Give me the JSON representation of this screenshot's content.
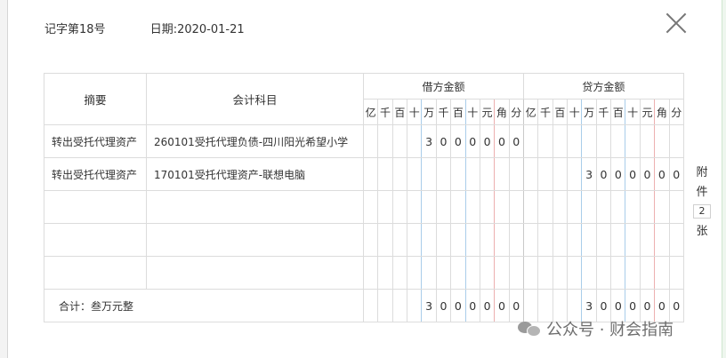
{
  "header": {
    "voucher_no": "记字第18号",
    "date": "日期:2020-01-21"
  },
  "table": {
    "col_summary": "摘要",
    "col_account": "会计科目",
    "debit_label": "借方金额",
    "credit_label": "贷方金额",
    "units": [
      "亿",
      "千",
      "百",
      "十",
      "万",
      "千",
      "百",
      "十",
      "元",
      "角",
      "分"
    ],
    "rows": [
      {
        "summary": "转出受托代理资产",
        "account": "260101受托代理负债-四川阳光希望小学",
        "debit": [
          "",
          "",
          "",
          "",
          "3",
          "0",
          "0",
          "0",
          "0",
          "0",
          "0"
        ],
        "credit": [
          "",
          "",
          "",
          "",
          "",
          "",
          "",
          "",
          "",
          "",
          ""
        ]
      },
      {
        "summary": "转出受托代理资产",
        "account": "170101受托代理资产-联想电脑",
        "debit": [
          "",
          "",
          "",
          "",
          "",
          "",
          "",
          "",
          "",
          "",
          ""
        ],
        "credit": [
          "",
          "",
          "",
          "",
          "3",
          "0",
          "0",
          "0",
          "0",
          "0",
          "0"
        ]
      },
      {
        "summary": "",
        "account": "",
        "debit": [
          "",
          "",
          "",
          "",
          "",
          "",
          "",
          "",
          "",
          "",
          ""
        ],
        "credit": [
          "",
          "",
          "",
          "",
          "",
          "",
          "",
          "",
          "",
          "",
          ""
        ]
      },
      {
        "summary": "",
        "account": "",
        "debit": [
          "",
          "",
          "",
          "",
          "",
          "",
          "",
          "",
          "",
          "",
          ""
        ],
        "credit": [
          "",
          "",
          "",
          "",
          "",
          "",
          "",
          "",
          "",
          "",
          ""
        ]
      },
      {
        "summary": "",
        "account": "",
        "debit": [
          "",
          "",
          "",
          "",
          "",
          "",
          "",
          "",
          "",
          "",
          ""
        ],
        "credit": [
          "",
          "",
          "",
          "",
          "",
          "",
          "",
          "",
          "",
          "",
          ""
        ]
      }
    ],
    "total": {
      "label": "合计：叁万元整",
      "debit": [
        "",
        "",
        "",
        "",
        "3",
        "0",
        "0",
        "0",
        "0",
        "0",
        "0"
      ],
      "credit": [
        "",
        "",
        "",
        "",
        "3",
        "0",
        "0",
        "0",
        "0",
        "0",
        "0"
      ]
    }
  },
  "attachment": {
    "label_top": "附",
    "label_mid": "件",
    "count": "2",
    "label_bottom": "张"
  },
  "watermark": {
    "icon": "wechat-icon",
    "text": "公众号 · 财会指南"
  },
  "colors": {
    "grid": "#dcdcdc",
    "thousand_separator": "#a9cdea",
    "yuan_separator": "#ecb0b0"
  }
}
